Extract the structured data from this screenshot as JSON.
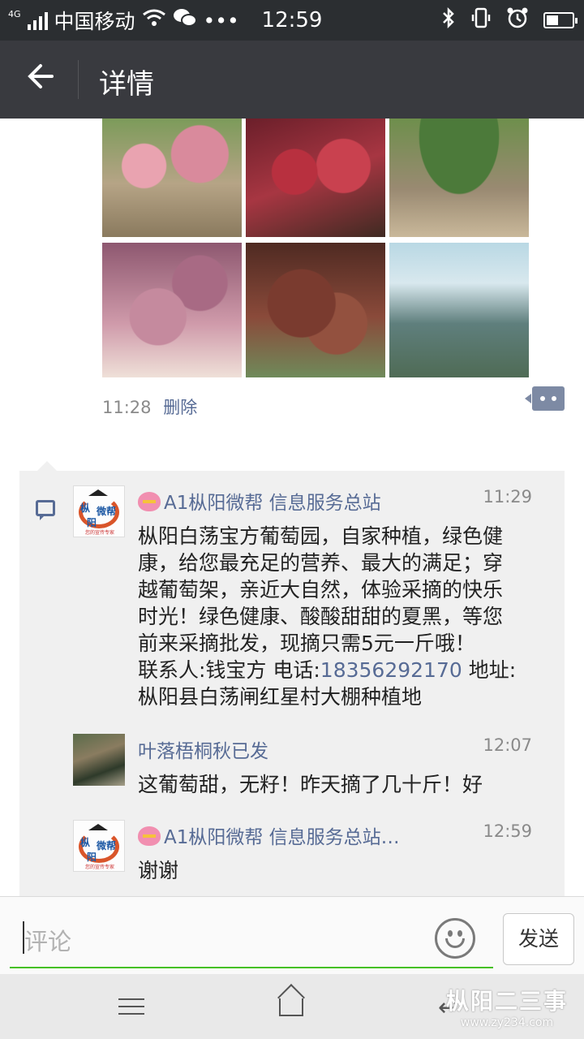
{
  "status_bar": {
    "network": "4G",
    "carrier": "中国移动",
    "more": "•••",
    "time": "12:59",
    "icons": [
      "signal-icon",
      "wifi-icon",
      "wechat-icon",
      "bluetooth-icon",
      "vibrate-icon",
      "alarm-icon",
      "battery-icon"
    ]
  },
  "header": {
    "back_icon": "back-arrow-icon",
    "title": "详情"
  },
  "post": {
    "photos": [
      "grape-photo",
      "grape-photo",
      "grape-photo",
      "grape-photo",
      "grape-photo",
      "greenhouse-photo"
    ],
    "time": "11:28",
    "delete_label": "删除"
  },
  "comments": [
    {
      "name": "A1枞阳微帮  信息服务总站",
      "time": "11:29",
      "lines": [
        "枞阳白荡宝方葡萄园，自家种植，绿色健",
        "康，给您最充足的营养、最大的满足；穿",
        "越葡萄架，亲近大自然，体验采摘的快乐",
        "时光！绿色健康、酸酸甜甜的夏黑，等您",
        "前来采摘批发，现摘只需5元一斤哦！"
      ],
      "contact_prefix": "联系人:钱宝方  电话:",
      "phone": "18356292170",
      "address_prefix": "  地址:",
      "address": "枞阳县白荡闸红星村大棚种植地",
      "avatar_text": {
        "a": "枞",
        "b": "微帮",
        "c": "阳",
        "tagline": "您的宣传专家"
      }
    },
    {
      "name": "叶落梧桐秋已发",
      "time": "12:07",
      "text": "这葡萄甜，无籽！昨天摘了几十斤！好"
    },
    {
      "name": "A1枞阳微帮  信息服务总站…",
      "time": "12:59",
      "text": "谢谢",
      "avatar_text": {
        "a": "枞",
        "b": "微帮",
        "c": "阳",
        "tagline": "您的宣传专家"
      }
    }
  ],
  "input_bar": {
    "placeholder": "评论",
    "send_label": "发送"
  },
  "watermark": {
    "line1": "枞阳二三事",
    "line2": "www.zy234.com"
  },
  "colors": {
    "link": "#576b95",
    "accent_green": "#45c01a",
    "title_bar": "#393a3f",
    "status_bar": "#2b2e31"
  }
}
